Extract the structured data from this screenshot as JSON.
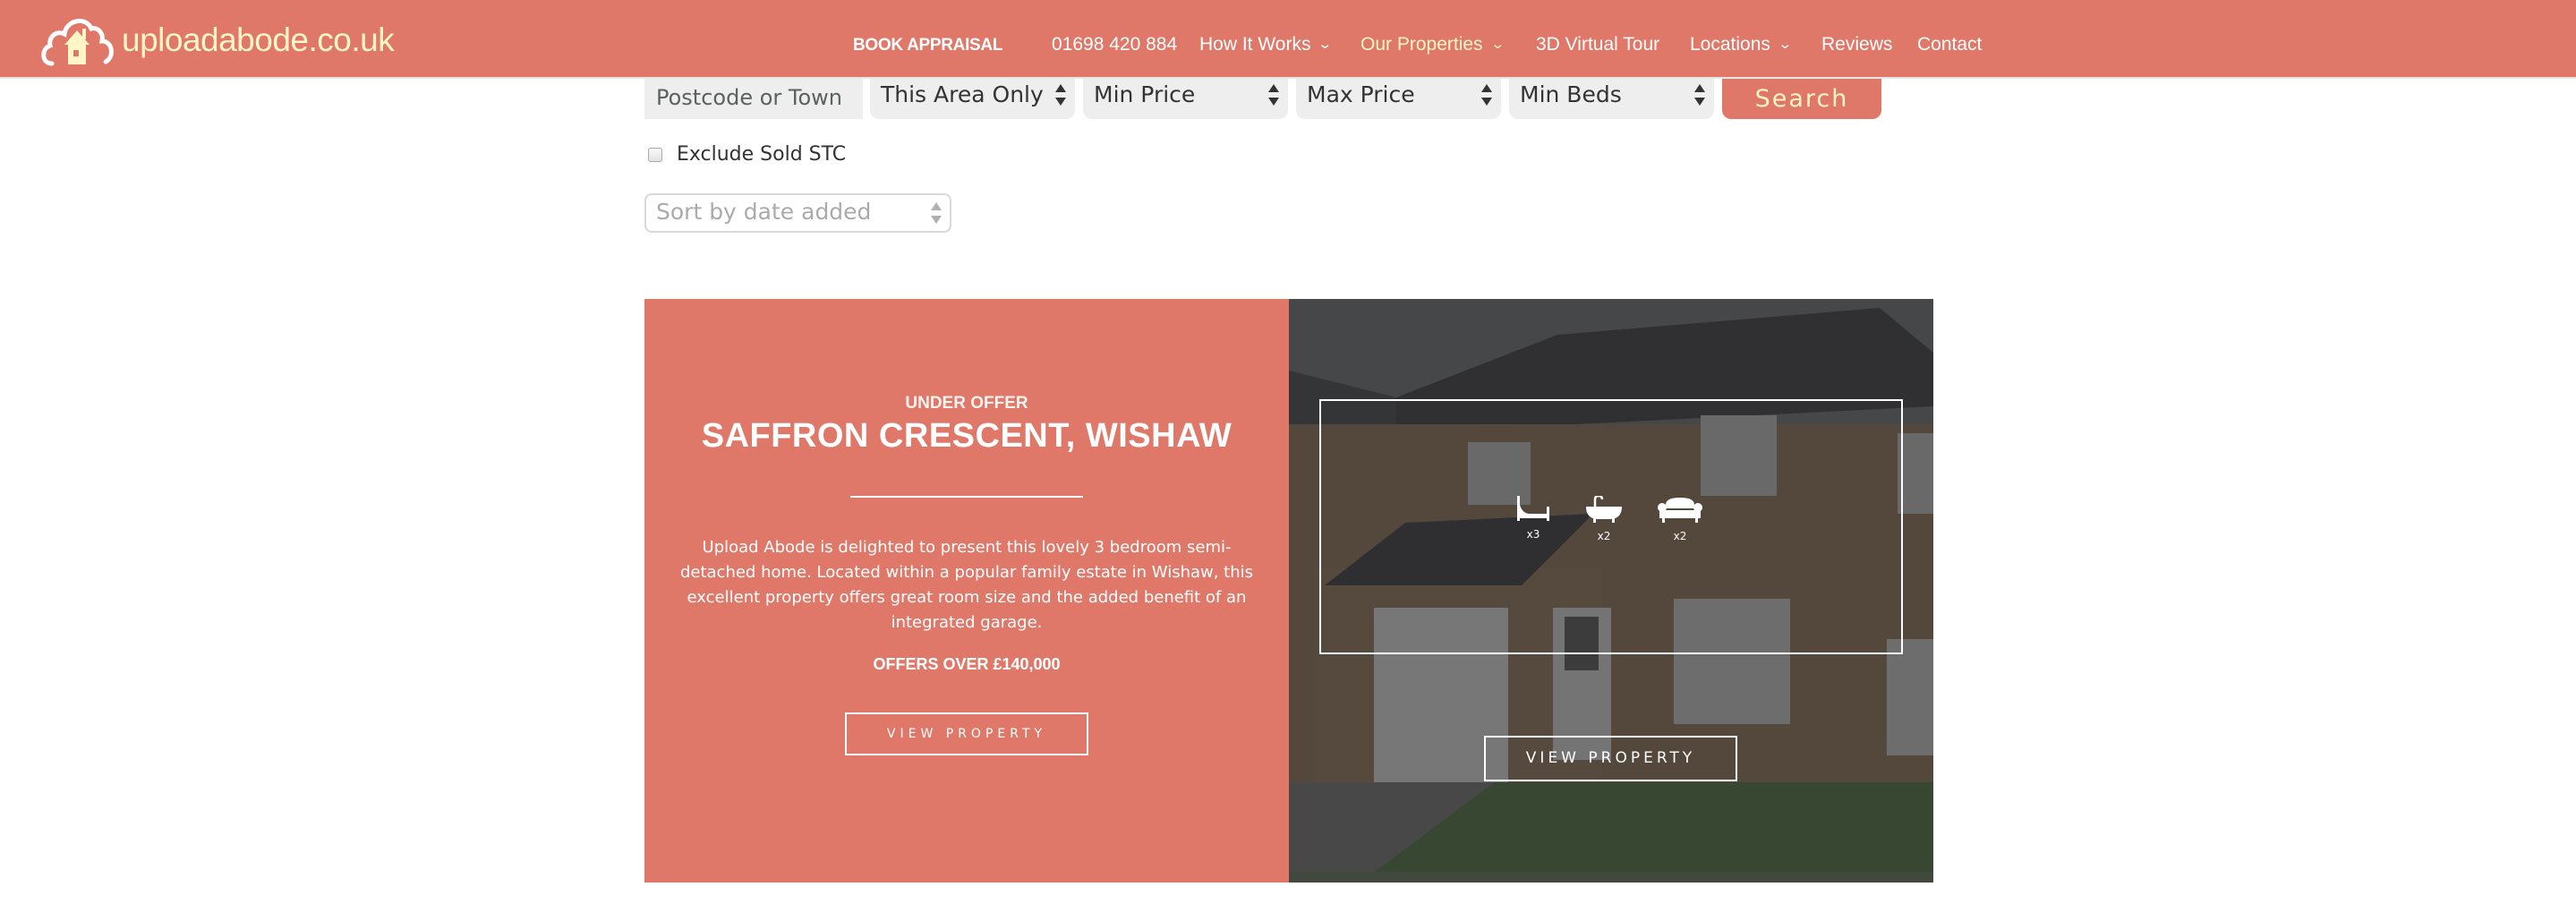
{
  "header": {
    "logo_text": "uploadabode.co.uk",
    "nav": [
      {
        "label": "BOOK APPRAISAL",
        "has_dropdown": false
      },
      {
        "label": "01698 420 884",
        "has_dropdown": false
      },
      {
        "label": "How It Works",
        "has_dropdown": true
      },
      {
        "label": "Our Properties",
        "has_dropdown": true,
        "active": true
      },
      {
        "label": "3D Virtual Tour",
        "has_dropdown": false
      },
      {
        "label": "Locations",
        "has_dropdown": true
      },
      {
        "label": "Reviews",
        "has_dropdown": false
      },
      {
        "label": "Contact",
        "has_dropdown": false
      }
    ],
    "chevron_glyph": "⌄"
  },
  "search": {
    "location_placeholder": "Postcode or Town",
    "radius_selected": "This Area Only",
    "min_price_selected": "Min Price",
    "max_price_selected": "Max Price",
    "min_beds_selected": "Min Beds",
    "search_label": "Search",
    "exclude_sold_label": "Exclude Sold STC",
    "exclude_sold_checked": false,
    "sort_selected": "Sort by date added"
  },
  "listing": {
    "status": "UNDER OFFER",
    "title": "SAFFRON CRESCENT, WISHAW",
    "description": "Upload Abode is delighted to present this lovely 3 bedroom semi-detached home. Located within a popular family estate in Wishaw, this excellent property offers great room size and the added benefit of an integrated garage.",
    "price": "OFFERS OVER £140,000",
    "view_label": "VIEW PROPERTY",
    "features": [
      {
        "icon": "bed-icon",
        "count": "x3"
      },
      {
        "icon": "bath-icon",
        "count": "x2"
      },
      {
        "icon": "sofa-icon",
        "count": "x2"
      }
    ],
    "image_view_label": "VIEW PROPERTY"
  },
  "colors": {
    "brand": "#df7869",
    "accent_cream": "#fff5c8",
    "field_bg": "#eeeeee"
  }
}
